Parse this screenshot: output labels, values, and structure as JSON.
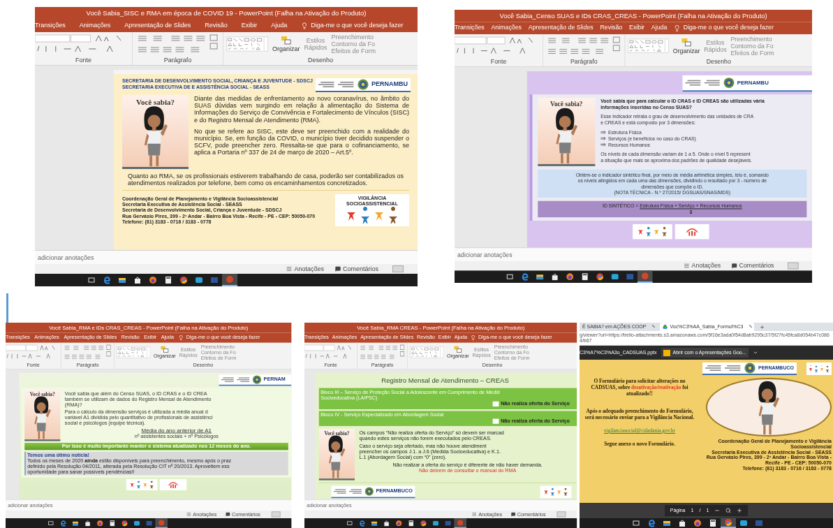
{
  "windows": [
    {
      "kind": "powerpoint",
      "title": "Você Sabia_SISC e RMA em época de COVID 19  -  PowerPoint (Falha na Ativação do Produto)",
      "menu": [
        "Transições",
        "Animações",
        "Apresentação de Slides",
        "Revisão",
        "Exibir",
        "Ajuda"
      ],
      "tell_me": "Diga-me o que você deseja fazer",
      "ribbon": {
        "groups": [
          "Fonte",
          "Parágrafo",
          "Desenho"
        ],
        "arrange": "Organizar",
        "quick_styles": [
          "Estilos",
          "Rápidos"
        ],
        "shape_options": [
          "Preenchimento",
          "Contorno da Fo",
          "Efeitos de Form"
        ]
      },
      "slide": {
        "kind": "covid",
        "header": [
          "SECRETARIA DE DESENVOLVIMENTO SOCIAL, CRIANÇA E JUVENTUDE - SDSCJ",
          "SECRETARIA EXECUTIVA DE E ASSISTÊNCIA SOCIAL - SEASS"
        ],
        "logo_text": "PERNAMBU",
        "card_title": "Você sabia?",
        "paragraphs": [
          "Diante das medidas de enfrentamento ao novo coranavírus, no âmbito do SUAS dúvidas vem surgindo em relação à alimentação do Sistema de Informações do Serviço de Convivência e Fortalecimento de Vínculos (SISC) e do Registro Mensal de Atendimento (RMA).",
          "No que se refere ao SISC, este deve ser preenchido com a realidade do município. Se, em função da COVID, o município tiver decidido suspender o SCFV, pode preencher zero. Ressalta-se que para o cofinanciamento, se aplica a Portaria nº 337 de 24 de março de 2020 – Art.5º.",
          "Quanto ao RMA, se os profissionais estiverem trabalhando de casa, poderão ser contabilizados os atendimentos realizados por telefone, bem como os encaminhamentos concretizados."
        ],
        "footer": [
          "Coordenação Geral de Planejamento e Vigilância Socioassistencial",
          "Secretaria Executiva de Assistência Social - SEASS",
          "Secretaria de Desenvolvimento Social, Criança e Juventude - SDSCJ",
          "Rua Gervásio Pires, 399 - 2º Andar - Bairro Boa Vista - Recife - PE - CEP: 50050-070",
          "Telefone: (81) 3183 - 0716 / 3183 - 0778"
        ],
        "badge": "VIGILÂNCIA SOCIOASSISTENCIAL"
      },
      "notes_placeholder": "adicionar anotações",
      "status": [
        "Anotações",
        "Comentários"
      ],
      "taskbar": [
        {
          "selected": false
        },
        {
          "selected": false
        },
        {
          "selected": false
        },
        {
          "selected": false
        },
        {
          "selected": false
        },
        {
          "selected": false
        },
        {
          "selected": false
        },
        {
          "selected": false
        },
        {
          "selected": false
        },
        {
          "selected": true
        }
      ]
    },
    {
      "kind": "powerpoint",
      "title": "Você Sabia_Censo SUAS e IDs CRAS_CREAS  -  PowerPoint (Falha na Ativação do Produto)",
      "menu": [
        "Transições",
        "Animações",
        "Apresentação de Slides",
        "Revisão",
        "Exibir",
        "Ajuda"
      ],
      "tell_me": "Diga-me o que você deseja fazer",
      "ribbon": {
        "groups": [
          "Fonte",
          "Parágrafo",
          "Desenho"
        ],
        "arrange": "Organizar",
        "quick_styles": [
          "Estilos",
          "Rápidos"
        ],
        "shape_options": [
          "Preenchimento",
          "Contorno da Fo",
          "Efeitos de Form"
        ]
      },
      "slide": {
        "kind": "censo",
        "logo_text": "PERNAMBU",
        "card_title": "Você sabia?",
        "question": [
          "Você sabia que para calcular o ID CRAS e ID CREAS são utilizadas vária",
          "informações inseridas no Censo SUAS?"
        ],
        "intro": [
          "Esse indicador retrata o grau de desenvolvimento das unidades de CRA",
          "e CREAS e está composto por 3 dimensões:"
        ],
        "bullets": [
          "Estrutura Física",
          "Serviços (e benefícios no caso do CRAS)",
          "Recursos Humanos"
        ],
        "levels": [
          "Os níveis de cada dimensão variam de 1 a 5. Onde o nível 5 represent",
          "a situação que mais se aproxima dos padrões de qualidade desejáveis."
        ],
        "note": [
          "Obtém-se o indicador sintético final, por meio de média aritmética simples, isto é, somando",
          "os níveis atingidos em cada uma das dimensões, dividindo o resultado por 3 - número de",
          "dimensões que compõe o ID."
        ],
        "source": "(NOTA TÉCNICA - N.º 27/2015/ DGSUAS/SNAS/MDS)",
        "formula_label": "ID SINTÉTICO = ",
        "numerator": "Estrutura Física + Serviço + Recursos Humanos",
        "denominator": "3"
      },
      "notes_placeholder": "adicionar anotações",
      "status": [
        "Anotações",
        "Comentários"
      ],
      "taskbar": [
        {
          "selected": false
        },
        {
          "selected": false
        },
        {
          "selected": false
        },
        {
          "selected": false
        },
        {
          "selected": false
        },
        {
          "selected": false
        },
        {
          "selected": false
        },
        {
          "selected": false
        },
        {
          "selected": false
        },
        {
          "selected": true
        }
      ]
    },
    {
      "kind": "powerpoint",
      "title": "Você Sabia_RMA e IDs CRAS_CREAS  -  PowerPoint (Falha na Ativação do Produto)",
      "menu": [
        "Transições",
        "Animações",
        "Apresentação de Slides",
        "Revisão",
        "Exibir",
        "Ajuda"
      ],
      "tell_me": "Diga-me o que você deseja fazer",
      "ribbon": {
        "groups": [
          "Fonte",
          "Parágrafo",
          "Desenho"
        ],
        "arrange": "Organizar",
        "quick_styles": [
          "Estilos",
          "Rápidos"
        ],
        "shape_options": [
          "Preenchimento",
          "Contorno da Fo",
          "Efeitos de Form"
        ]
      },
      "slide": {
        "kind": "rma",
        "logo_text": "PERNAM",
        "card_title": "Você sabia?",
        "question": [
          "Você sabia que além do Censo SUAS, o ID CRAS e o ID CREA",
          "também se utilizam de dados do Registro Mensal de Atendimento",
          "(RMA)?"
        ],
        "explanation": [
          "Para o cálculo da dimensão serviços é utilizada a média anual  d",
          "variável A1 dividida pelo quantitativo de profissionais de assistênci",
          "social e psicólogos (equipe técnica)."
        ],
        "numerator": "Média do ano anterior de A1",
        "denominator": "nº assistentes sociais + nº Psicólogos",
        "banner": "Por isso é muito importante manter o sistema atualizado nos 12 meses do ano.",
        "news_title": "Temos uma ótimo notícia!",
        "news": [
          "Todos os meses de 2020 **ainda** estão disponíveis para preenchimento, mesmo após o praz",
          "definido pela Resolução 04/2011, alterada pela Resolução CIT nº 20/2013. Aproveitem ess",
          "oportunidade para sanar possíveis pendências!!"
        ]
      },
      "notes_placeholder": "adicionar anotações",
      "status": [
        "Anotações",
        "Comentários"
      ],
      "taskbar": [
        {
          "selected": false
        },
        {
          "selected": false
        },
        {
          "selected": false
        },
        {
          "selected": false
        },
        {
          "selected": false
        },
        {
          "selected": false
        },
        {
          "selected": false
        },
        {
          "selected": false
        },
        {
          "selected": false
        },
        {
          "selected": true
        }
      ]
    },
    {
      "kind": "powerpoint",
      "title": "Você Sabia_RMA CREAS  -  PowerPoint (Falha na Ativação do Produto)",
      "menu": [
        "Transições",
        "Animações",
        "Apresentação de Slides",
        "Revisão",
        "Exibir",
        "Ajuda"
      ],
      "tell_me": "Diga-me o que você deseja fazer",
      "ribbon": {
        "groups": [
          "Fonte",
          "Parágrafo",
          "Desenho"
        ],
        "arrange": "Organizar",
        "quick_styles": [
          "Estilos",
          "Rápidos"
        ],
        "shape_options": [
          "Preenchimento",
          "Contorno da Fo",
          "Efeitos de Form"
        ]
      },
      "slide": {
        "kind": "creas",
        "heading": "Registro Mensal de Atendimento – CREAS",
        "blocks": [
          {
            "lines": [
              "Bloco III – Serviço de Proteção Social a Adolescente em Cumprimento de Medid",
              "Socioeducativa (LA/PSC)"
            ],
            "checkbox_label": "Não realiza oferta do Serviço",
            "checked": false
          },
          {
            "lines": [
              "Bloco IV - Serviço Especializado em Abordagem Social"
            ],
            "checkbox_label": "Não realiza oferta do Serviço",
            "checked": false
          }
        ],
        "card_title": "Você sabia?",
        "paragraphs": [
          [
            "Os campos “Não realiza oferta do Serviço” só devem ser marcad",
            "quando estes serviços não forem executados pelo CREAS."
          ],
          [
            "Caso o serviço seja ofertado, mas não houve atendiment",
            "preencher os campos J.1. a J.6 (Medida Socioeducativa) e K.1.",
            "L.1 (Abordagem Social) com “0” (zero)."
          ]
        ],
        "note": "Não realizar a oferta do serviço é diferente de não haver demanda.",
        "warning": "Não deixem de consultar o manual do RMA",
        "logo_text": "PERNAMBUCO"
      },
      "notes_placeholder": "adicionar anotações",
      "status": [
        "Anotações",
        "Comentários"
      ],
      "taskbar": [
        {
          "selected": false
        },
        {
          "selected": false
        },
        {
          "selected": false
        },
        {
          "selected": false
        },
        {
          "selected": false
        },
        {
          "selected": false
        },
        {
          "selected": false
        },
        {
          "selected": false
        },
        {
          "selected": false
        },
        {
          "selected": true
        }
      ]
    },
    {
      "kind": "browser",
      "tabs": [
        {
          "label": "Ê SABIA? em AÇÕES COOP",
          "selected": false
        },
        {
          "label": "Voc%C3%AA_Sabia_Formul%C3",
          "selected": true
        }
      ],
      "url": "g/viewer?url=https://trello-attachments.s3.amazonaws.com/5f16e3ada0f54d8ab9295c37/5f27fc45fca8d054b47c0864/b67",
      "file_name": "C3%A7%C3%A3o_CADSUAS.pptx",
      "open_with": "Abrir com o Apresentações Goo...",
      "slide": {
        "kind": "cadsuas",
        "logo_text": "PERNAMBUCO",
        "intro_before": "O Formulário para solicitar alterações no CADSUAS, sobre ",
        "highlight": "desativação/reativação",
        "intro_after": "foi atualizado!!",
        "instruction": "Após o adequado preenchimento do Formulário, será necessário enviar  para a Vigilância Nacional.",
        "email": "vigilanciasocial@cidadania.gov.br",
        "attachment": "Segue  anexo o novo Formulário.",
        "footer": [
          "Coordenação Geral de Planejamento e Vigilância",
          "Socioassistencial",
          "Secretaria Executiva de Assistência Social - SEASS",
          "Rua Gervásio Pires, 399 - 2º Andar - Bairro Boa Vista -",
          "Recife - PE - CEP: 50050-070",
          "Telefone: (81) 3183 - 0716 / 3183 - 0778"
        ]
      },
      "page": {
        "label": "Página",
        "current": "1",
        "separator": "/",
        "total": "1"
      },
      "taskbar": [
        {
          "selected": false
        },
        {
          "selected": false
        },
        {
          "selected": false
        },
        {
          "selected": false
        },
        {
          "selected": false
        },
        {
          "selected": false
        },
        {
          "selected": true
        },
        {
          "selected": false
        },
        {
          "selected": false
        }
      ]
    }
  ]
}
